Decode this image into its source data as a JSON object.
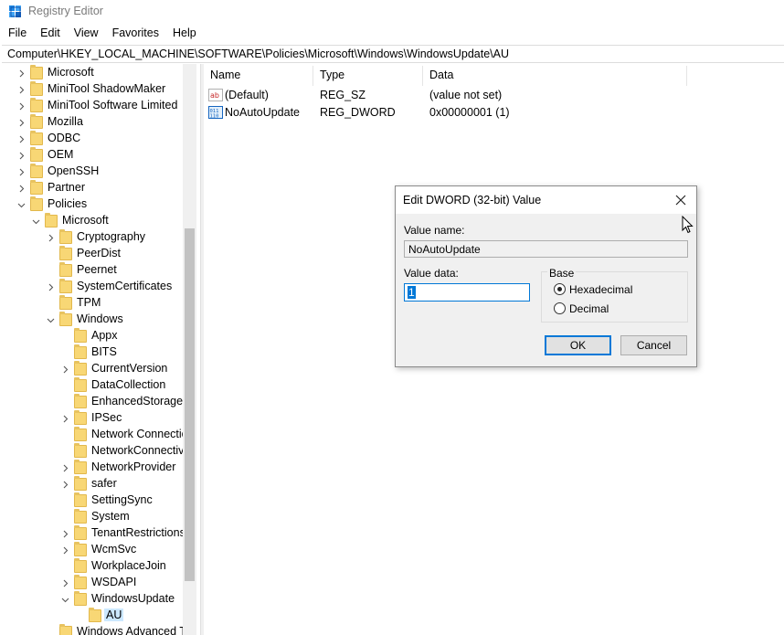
{
  "window": {
    "title": "Registry Editor",
    "menu": [
      "File",
      "Edit",
      "View",
      "Favorites",
      "Help"
    ],
    "address": "Computer\\HKEY_LOCAL_MACHINE\\SOFTWARE\\Policies\\Microsoft\\Windows\\WindowsUpdate\\AU"
  },
  "tree": {
    "items": [
      {
        "label": "Microsoft",
        "chevron": "right"
      },
      {
        "label": "MiniTool ShadowMaker",
        "chevron": "right"
      },
      {
        "label": "MiniTool Software Limited",
        "chevron": "right"
      },
      {
        "label": "Mozilla",
        "chevron": "right"
      },
      {
        "label": "ODBC",
        "chevron": "right"
      },
      {
        "label": "OEM",
        "chevron": "right"
      },
      {
        "label": "OpenSSH",
        "chevron": "right"
      },
      {
        "label": "Partner",
        "chevron": "right"
      },
      {
        "label": "Policies",
        "chevron": "down"
      },
      {
        "label": "Microsoft",
        "chevron": "down"
      },
      {
        "label": "Cryptography",
        "chevron": "right"
      },
      {
        "label": "PeerDist",
        "chevron": ""
      },
      {
        "label": "Peernet",
        "chevron": ""
      },
      {
        "label": "SystemCertificates",
        "chevron": "right"
      },
      {
        "label": "TPM",
        "chevron": ""
      },
      {
        "label": "Windows",
        "chevron": "down"
      },
      {
        "label": "Appx",
        "chevron": ""
      },
      {
        "label": "BITS",
        "chevron": ""
      },
      {
        "label": "CurrentVersion",
        "chevron": "right"
      },
      {
        "label": "DataCollection",
        "chevron": ""
      },
      {
        "label": "EnhancedStorageD",
        "chevron": ""
      },
      {
        "label": "IPSec",
        "chevron": "right"
      },
      {
        "label": "Network Connectio",
        "chevron": ""
      },
      {
        "label": "NetworkConnectiv",
        "chevron": ""
      },
      {
        "label": "NetworkProvider",
        "chevron": "right"
      },
      {
        "label": "safer",
        "chevron": "right"
      },
      {
        "label": "SettingSync",
        "chevron": ""
      },
      {
        "label": "System",
        "chevron": ""
      },
      {
        "label": "TenantRestrictions",
        "chevron": "right"
      },
      {
        "label": "WcmSvc",
        "chevron": "right"
      },
      {
        "label": "WorkplaceJoin",
        "chevron": ""
      },
      {
        "label": "WSDAPI",
        "chevron": "right"
      },
      {
        "label": "WindowsUpdate",
        "chevron": "down"
      },
      {
        "label": "AU",
        "chevron": "",
        "selected": true
      },
      {
        "label": "Windows Advanced T",
        "chevron": ""
      }
    ]
  },
  "list": {
    "columns": [
      "Name",
      "Type",
      "Data"
    ],
    "rows": [
      {
        "name": "(Default)",
        "type": "REG_SZ",
        "data": "(value not set)",
        "icon": "string-value-icon"
      },
      {
        "name": "NoAutoUpdate",
        "type": "REG_DWORD",
        "data": "0x00000001 (1)",
        "icon": "dword-value-icon"
      }
    ]
  },
  "dialog": {
    "title": "Edit DWORD (32-bit) Value",
    "value_name_label": "Value name:",
    "value_name": "NoAutoUpdate",
    "value_data_label": "Value data:",
    "value_data": "1",
    "base_label": "Base",
    "hex_label": "Hexadecimal",
    "decimal_label": "Decimal",
    "base_selected": "Hexadecimal",
    "ok_label": "OK",
    "cancel_label": "Cancel"
  },
  "colors": {
    "folder": "#f8d775",
    "selection": "#cce8ff",
    "accent": "#0078d7",
    "dialog_bg": "#f0f0f0"
  }
}
